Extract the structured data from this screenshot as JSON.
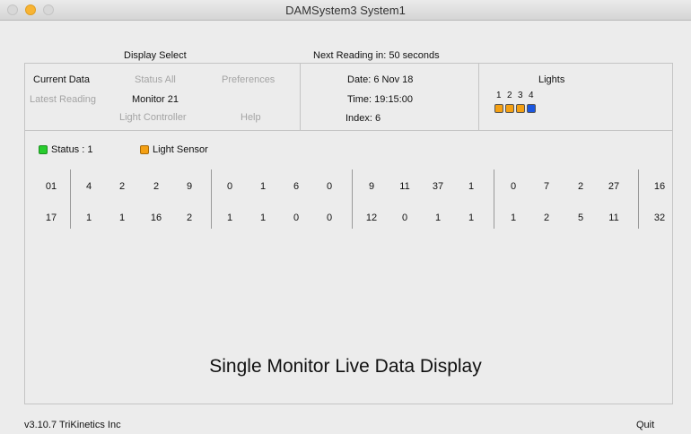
{
  "window": {
    "title": "DAMSystem3   System1"
  },
  "header": {
    "display_select": "Display Select",
    "next_reading": "Next Reading in:  50  seconds"
  },
  "menu": {
    "current_data": "Current Data",
    "status_all": "Status All",
    "preferences": "Preferences",
    "latest_reading": "Latest Reading",
    "monitor": "Monitor 21",
    "light_controller": "Light Controller",
    "help": "Help"
  },
  "info": {
    "date": "Date:  6 Nov 18",
    "time": "Time:  19:15:00",
    "index": "Index:  6"
  },
  "lights": {
    "title": "Lights",
    "numbers": [
      "1",
      "2",
      "3",
      "4"
    ],
    "colors": [
      "#f4a013",
      "#f4a013",
      "#f4a013",
      "#1b57e0"
    ]
  },
  "legend": {
    "status": "Status  :  1",
    "status_color": "#28cc2e",
    "light_sensor": "Light Sensor",
    "light_sensor_color": "#f4a013"
  },
  "data_rows": [
    [
      "01",
      "4",
      "2",
      "2",
      "9",
      "0",
      "1",
      "6",
      "0",
      "9",
      "11",
      "37",
      "1",
      "0",
      "7",
      "2",
      "27",
      "16"
    ],
    [
      "17",
      "1",
      "1",
      "16",
      "2",
      "1",
      "1",
      "0",
      "0",
      "12",
      "0",
      "1",
      "1",
      "1",
      "2",
      "5",
      "11",
      "32"
    ]
  ],
  "caption": "Single Monitor Live Data Display",
  "footer": {
    "version": "v3.10.7  TriKinetics Inc",
    "quit": "Quit"
  }
}
